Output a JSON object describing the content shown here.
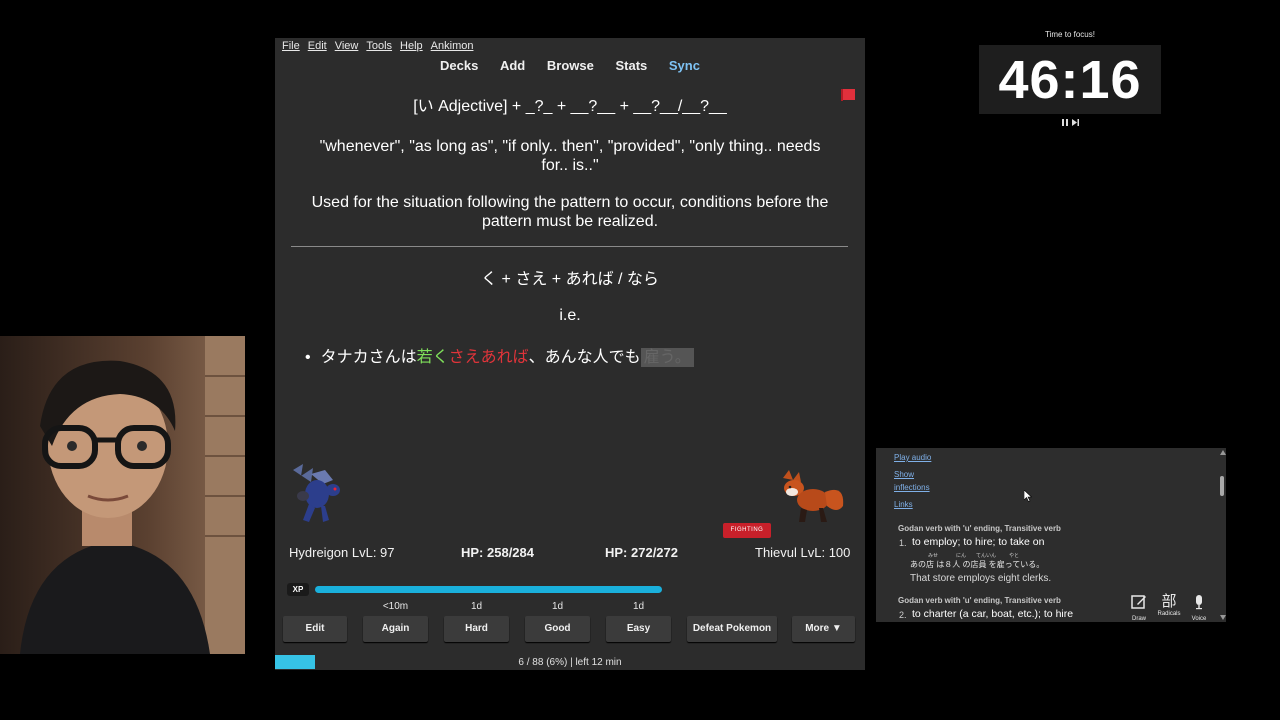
{
  "menu": [
    "File",
    "Edit",
    "View",
    "Tools",
    "Help",
    "Ankimon"
  ],
  "toolbar": [
    "Decks",
    "Add",
    "Browse",
    "Stats",
    "Sync"
  ],
  "card": {
    "pattern": "[い Adjective] + _?_ + __?__ + __?__/__?__",
    "meanings": "\"whenever\", \"as long as\", \"if only.. then\", \"provided\", \"only thing.. needs for.. is..\"",
    "usage": "Used for the situation following the pattern to occur, conditions before the pattern must be realized.",
    "formation": "く + さえ + あれば / なら",
    "ie": "i.e.",
    "example": {
      "part1": "タナカさんは",
      "part2": "若く",
      "part3": "さえあれば",
      "part4": "、あんな人でも",
      "part5": "雇う。"
    }
  },
  "battle": {
    "player": "Hydreigon LvL: 97",
    "player_hp": "HP: 258/284",
    "enemy_hp": "HP: 272/272",
    "enemy": "Thievul LvL: 100",
    "type_badge": "FIGHTING",
    "xp_label": "XP",
    "xp_fraction": 0.62
  },
  "answers": {
    "intervals": [
      "<10m",
      "1d",
      "1d",
      "1d"
    ],
    "buttons": [
      "Edit",
      "Again",
      "Hard",
      "Good",
      "Easy",
      "Defeat Pokemon",
      "More ▼"
    ]
  },
  "progress": "6 / 88 (6%) | left 12 min",
  "timer": {
    "title": "Time to focus!",
    "time": "46:16"
  },
  "dictionary": {
    "play_audio": "Play audio",
    "show": "Show",
    "inflections": "inflections",
    "links": "Links",
    "pos1": "Godan verb with 'u' ending, Transitive verb",
    "num1": "1.",
    "def1": "to employ; to hire; to take on",
    "jp_example": "あの店 は８人 の店員 を雇っている。",
    "furigana": [
      "みせ",
      "にん",
      "てんいん",
      "やと"
    ],
    "en_example": "That store employs eight clerks.",
    "pos2": "Godan verb with 'u' ending, Transitive verb",
    "num2": "2.",
    "def2": "to charter (a car, boat, etc.); to hire",
    "tools": [
      "Draw",
      "Radicals",
      "Voice"
    ],
    "radical_glyph": "部"
  }
}
